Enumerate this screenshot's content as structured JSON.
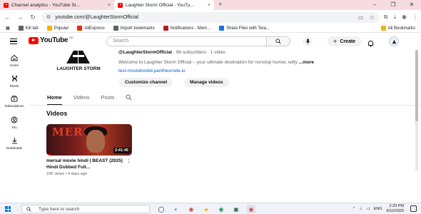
{
  "browser": {
    "tabs": [
      {
        "title": "Channel analytics - YouTube St...",
        "active": false
      },
      {
        "title": "Laughter Storm Official - YouTu...",
        "active": true
      }
    ],
    "new_tab": "+",
    "close": "×",
    "url": "youtube.com/@LaughterStormOfficial",
    "bookmarks": [
      {
        "label": "Kill tab",
        "color": "#5f6368"
      },
      {
        "label": "Popular",
        "color": "#f4b400"
      },
      {
        "label": "AliExpress",
        "color": "#e62e04"
      },
      {
        "label": "Import bookmarks",
        "color": "#5f6368"
      },
      {
        "label": "Notifications - Mem...",
        "color": "#b71c1c"
      },
      {
        "label": "Share Files with Tera...",
        "color": "#1a73e8"
      }
    ],
    "all_bookmarks": "All Bookmarks"
  },
  "youtube": {
    "logo_text": "YouTube",
    "region": "BD",
    "search_placeholder": "Search",
    "create_label": "Create",
    "guide": [
      {
        "label": "Home",
        "icon": "home-icon"
      },
      {
        "label": "Shorts",
        "icon": "shorts-icon"
      },
      {
        "label": "Subscriptions",
        "icon": "subscriptions-icon"
      },
      {
        "label": "You",
        "icon": "you-icon"
      },
      {
        "label": "Downloads",
        "icon": "downloads-icon"
      }
    ]
  },
  "channel": {
    "logo_text": "LAUGHTER STORM",
    "handle": "@LaughterStormOfficial",
    "stats": " · 96 subscribers · 1 video",
    "description": "Welcome to Laughter Storm Official – your ultimate destination for nonstop humor, witty",
    "more": "...more",
    "link": "test-movieboxbd.pantheonsite.io",
    "customize_label": "Customize channel",
    "manage_label": "Manage videos",
    "tabs": [
      "Home",
      "Videos",
      "Posts"
    ],
    "section_title": "Videos"
  },
  "video": {
    "thumbnail_word": "MERS",
    "duration": "2:41:45",
    "progress": 0.05,
    "title": "mersal movie hindi | BEAST (2025) Hindi Dubbed Full...",
    "meta": "10K views • 4 days ago"
  },
  "taskbar": {
    "search_placeholder": "Type here to search",
    "language": "ENG",
    "time": "2:29 PM",
    "date": "8/10/2025"
  }
}
